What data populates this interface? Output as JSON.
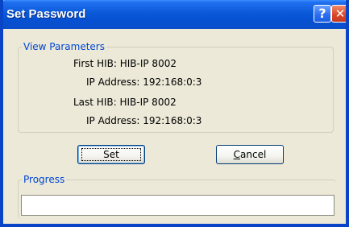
{
  "window": {
    "title": "Set Password"
  },
  "titlebar": {
    "help_glyph": "?",
    "close_glyph": "✕",
    "help_icon": "help-icon",
    "close_icon": "close-icon"
  },
  "view_parameters": {
    "legend": "View Parameters",
    "first_hib": "First HIB: HIB-IP 8002",
    "first_ip": "IP Address: 192:168:0:3",
    "last_hib": "Last HIB: HIB-IP 8002",
    "last_ip": "IP Address: 192:168:0:3"
  },
  "buttons": {
    "set_label": "Set",
    "cancel_label": "Cancel"
  },
  "progress": {
    "legend": "Progress",
    "value": 0
  },
  "colors": {
    "titlebar": "#0a5ad8",
    "dialog_bg": "#ece9d8",
    "legend_text": "#0046d5",
    "close_button": "#d8452a"
  }
}
